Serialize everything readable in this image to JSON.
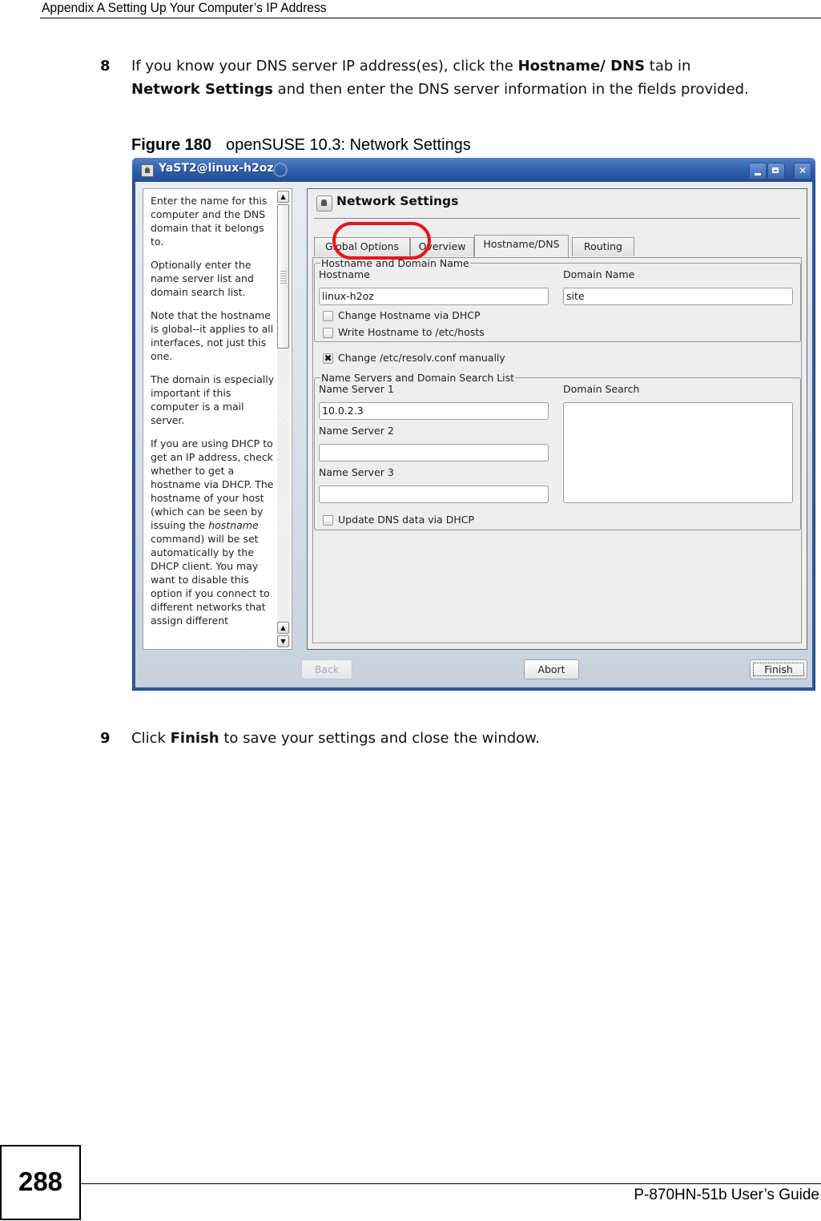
{
  "header": {
    "title": "Appendix A Setting Up Your Computer’s IP Address"
  },
  "steps": {
    "step8": {
      "number": "8",
      "text_1": "If you know your DNS server IP address(es), click the ",
      "bold_1": "Hostname/ DNS",
      "text_2": " tab in ",
      "bold_2": "Network Settings",
      "text_3": " and then enter the DNS server information in the fields provided."
    },
    "step9": {
      "number": "9",
      "text_1": "Click ",
      "bold_1": "Finish",
      "text_2": " to save your settings and close the window."
    }
  },
  "figure": {
    "label": "Figure 180",
    "caption": "openSUSE 10.3: Network Settings"
  },
  "window": {
    "title": "YaST2@linux-h2oz",
    "accent_color": "#2f5a9e",
    "highlight_color": "#e8141a",
    "help_text": [
      "Enter the name for this computer and the DNS domain that it belongs to.",
      "Optionally enter the name server list and domain search list.",
      "Note that the hostname is global--it applies to all interfaces, not just this one.",
      "The domain is especially important if this computer is a mail server.",
      "If you are using DHCP to get an IP address, check whether to get a hostname via DHCP. The hostname of your host (which can be seen by issuing the ",
      "hostname",
      " command) will be set automatically by the DHCP client. You may want to disable this option if you connect to different networks that assign different"
    ],
    "module_title": "Network Settings",
    "tabs": [
      {
        "label": "Global Options"
      },
      {
        "label": "Overview"
      },
      {
        "label": "Hostname/DNS",
        "active": true
      },
      {
        "label": "Routing"
      }
    ],
    "hostname_group": {
      "legend": "Hostname and Domain Name",
      "hostname_label": "Hostname",
      "hostname_value": "linux-h2oz",
      "domain_label": "Domain Name",
      "domain_value": "site",
      "change_via_dhcp": {
        "label": "Change Hostname via DHCP",
        "checked": false
      },
      "write_to_hosts": {
        "label": "Write Hostname to /etc/hosts",
        "checked": false
      }
    },
    "resolv_manual": {
      "label": "Change /etc/resolv.conf manually",
      "checked": true,
      "mark": "✖"
    },
    "ns_group": {
      "legend": "Name Servers and Domain Search List",
      "ns1_label": "Name Server 1",
      "ns1_value": "10.0.2.3",
      "ns2_label": "Name Server 2",
      "ns2_value": "",
      "ns3_label": "Name Server 3",
      "ns3_value": "",
      "domain_search_label": "Domain Search",
      "domain_search_value": "",
      "update_dns": {
        "label": "Update DNS data via DHCP",
        "checked": false
      }
    },
    "buttons": {
      "back": "Back",
      "abort": "Abort",
      "finish": "Finish"
    }
  },
  "footer": {
    "page_number": "288",
    "guide": "P-870HN-51b User’s Guide"
  }
}
